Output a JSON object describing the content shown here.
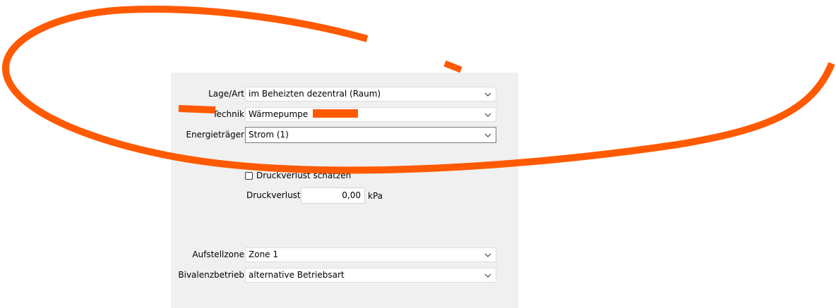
{
  "form": {
    "lage_art": {
      "label": "Lage/Art",
      "value": "im Beheizten dezentral (Raum)"
    },
    "technik": {
      "label": "Technik",
      "value": "Wärmepumpe"
    },
    "energietraeger": {
      "label": "Energieträger",
      "value": "Strom (1)"
    },
    "druckverlust_schaetzen": {
      "label": "Druckverlust schätzen",
      "checked": false
    },
    "druckverlust": {
      "label": "Druckverlust",
      "value": "0,00",
      "unit": "kPa"
    },
    "aufstellzone": {
      "label": "Aufstellzone",
      "value": "Zone 1"
    },
    "bivalenzbetrieb": {
      "label": "Bivalenzbetrieb",
      "value": "alternative Betriebsart"
    }
  },
  "colors": {
    "annotation": "#ff5a00",
    "panel_bg": "#f0f0f0"
  },
  "icons": {
    "dropdown": "chevron-down-icon"
  }
}
